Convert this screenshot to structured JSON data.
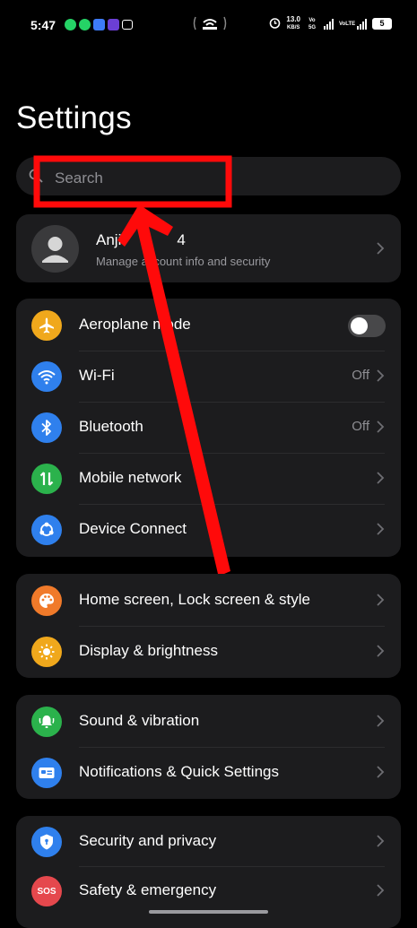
{
  "status_bar": {
    "time": "5:47",
    "center_icon": "hotspot-icon",
    "speed": "13.0",
    "speed_unit": "KB/S",
    "sim1": "Vo 5G",
    "sim2": "VoLTE",
    "battery": "5"
  },
  "page": {
    "title": "Settings"
  },
  "search": {
    "placeholder": "Search"
  },
  "account": {
    "name": "Anji",
    "name_tail": "4",
    "subtitle": "Manage account info and security"
  },
  "groups": [
    {
      "items": [
        {
          "label": "Aeroplane mode",
          "icon": "airplane-icon",
          "color": "#F0A81C",
          "control": "toggle",
          "toggle_on": false
        },
        {
          "label": "Wi-Fi",
          "icon": "wifi-icon",
          "color": "#2F80ED",
          "value": "Off"
        },
        {
          "label": "Bluetooth",
          "icon": "bluetooth-icon",
          "color": "#2F80ED",
          "value": "Off"
        },
        {
          "label": "Mobile network",
          "icon": "mobile-data-icon",
          "color": "#2BB24C"
        },
        {
          "label": "Device Connect",
          "icon": "device-connect-icon",
          "color": "#2F80ED"
        }
      ]
    },
    {
      "items": [
        {
          "label": "Home screen, Lock screen & style",
          "icon": "palette-icon",
          "color": "#F07A2A"
        },
        {
          "label": "Display & brightness",
          "icon": "brightness-icon",
          "color": "#F0A81C"
        }
      ]
    },
    {
      "items": [
        {
          "label": "Sound & vibration",
          "icon": "bell-icon",
          "color": "#2BB24C"
        },
        {
          "label": "Notifications & Quick Settings",
          "icon": "notifications-icon",
          "color": "#2F80ED"
        }
      ]
    },
    {
      "items": [
        {
          "label": "Security and privacy",
          "icon": "shield-icon",
          "color": "#2F80ED"
        },
        {
          "label": "Safety & emergency",
          "icon": "sos-icon",
          "color": "#E5484D",
          "icon_text": "SOS"
        }
      ]
    }
  ],
  "annotation": {
    "color": "#FF0A0A"
  }
}
